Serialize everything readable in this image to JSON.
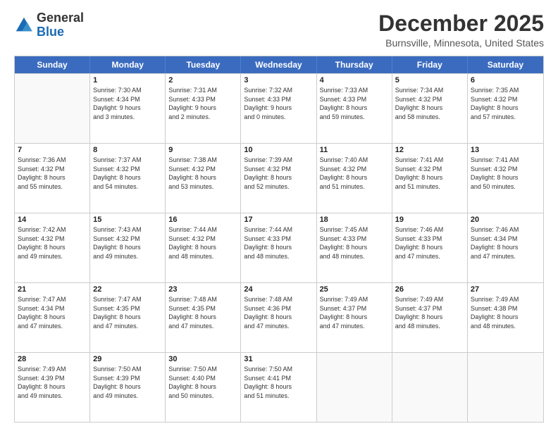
{
  "logo": {
    "general": "General",
    "blue": "Blue"
  },
  "title": "December 2025",
  "location": "Burnsville, Minnesota, United States",
  "days_of_week": [
    "Sunday",
    "Monday",
    "Tuesday",
    "Wednesday",
    "Thursday",
    "Friday",
    "Saturday"
  ],
  "weeks": [
    [
      {
        "num": "",
        "info": ""
      },
      {
        "num": "1",
        "info": "Sunrise: 7:30 AM\nSunset: 4:34 PM\nDaylight: 9 hours\nand 3 minutes."
      },
      {
        "num": "2",
        "info": "Sunrise: 7:31 AM\nSunset: 4:33 PM\nDaylight: 9 hours\nand 2 minutes."
      },
      {
        "num": "3",
        "info": "Sunrise: 7:32 AM\nSunset: 4:33 PM\nDaylight: 9 hours\nand 0 minutes."
      },
      {
        "num": "4",
        "info": "Sunrise: 7:33 AM\nSunset: 4:33 PM\nDaylight: 8 hours\nand 59 minutes."
      },
      {
        "num": "5",
        "info": "Sunrise: 7:34 AM\nSunset: 4:32 PM\nDaylight: 8 hours\nand 58 minutes."
      },
      {
        "num": "6",
        "info": "Sunrise: 7:35 AM\nSunset: 4:32 PM\nDaylight: 8 hours\nand 57 minutes."
      }
    ],
    [
      {
        "num": "7",
        "info": "Sunrise: 7:36 AM\nSunset: 4:32 PM\nDaylight: 8 hours\nand 55 minutes."
      },
      {
        "num": "8",
        "info": "Sunrise: 7:37 AM\nSunset: 4:32 PM\nDaylight: 8 hours\nand 54 minutes."
      },
      {
        "num": "9",
        "info": "Sunrise: 7:38 AM\nSunset: 4:32 PM\nDaylight: 8 hours\nand 53 minutes."
      },
      {
        "num": "10",
        "info": "Sunrise: 7:39 AM\nSunset: 4:32 PM\nDaylight: 8 hours\nand 52 minutes."
      },
      {
        "num": "11",
        "info": "Sunrise: 7:40 AM\nSunset: 4:32 PM\nDaylight: 8 hours\nand 51 minutes."
      },
      {
        "num": "12",
        "info": "Sunrise: 7:41 AM\nSunset: 4:32 PM\nDaylight: 8 hours\nand 51 minutes."
      },
      {
        "num": "13",
        "info": "Sunrise: 7:41 AM\nSunset: 4:32 PM\nDaylight: 8 hours\nand 50 minutes."
      }
    ],
    [
      {
        "num": "14",
        "info": "Sunrise: 7:42 AM\nSunset: 4:32 PM\nDaylight: 8 hours\nand 49 minutes."
      },
      {
        "num": "15",
        "info": "Sunrise: 7:43 AM\nSunset: 4:32 PM\nDaylight: 8 hours\nand 49 minutes."
      },
      {
        "num": "16",
        "info": "Sunrise: 7:44 AM\nSunset: 4:32 PM\nDaylight: 8 hours\nand 48 minutes."
      },
      {
        "num": "17",
        "info": "Sunrise: 7:44 AM\nSunset: 4:33 PM\nDaylight: 8 hours\nand 48 minutes."
      },
      {
        "num": "18",
        "info": "Sunrise: 7:45 AM\nSunset: 4:33 PM\nDaylight: 8 hours\nand 48 minutes."
      },
      {
        "num": "19",
        "info": "Sunrise: 7:46 AM\nSunset: 4:33 PM\nDaylight: 8 hours\nand 47 minutes."
      },
      {
        "num": "20",
        "info": "Sunrise: 7:46 AM\nSunset: 4:34 PM\nDaylight: 8 hours\nand 47 minutes."
      }
    ],
    [
      {
        "num": "21",
        "info": "Sunrise: 7:47 AM\nSunset: 4:34 PM\nDaylight: 8 hours\nand 47 minutes."
      },
      {
        "num": "22",
        "info": "Sunrise: 7:47 AM\nSunset: 4:35 PM\nDaylight: 8 hours\nand 47 minutes."
      },
      {
        "num": "23",
        "info": "Sunrise: 7:48 AM\nSunset: 4:35 PM\nDaylight: 8 hours\nand 47 minutes."
      },
      {
        "num": "24",
        "info": "Sunrise: 7:48 AM\nSunset: 4:36 PM\nDaylight: 8 hours\nand 47 minutes."
      },
      {
        "num": "25",
        "info": "Sunrise: 7:49 AM\nSunset: 4:37 PM\nDaylight: 8 hours\nand 47 minutes."
      },
      {
        "num": "26",
        "info": "Sunrise: 7:49 AM\nSunset: 4:37 PM\nDaylight: 8 hours\nand 48 minutes."
      },
      {
        "num": "27",
        "info": "Sunrise: 7:49 AM\nSunset: 4:38 PM\nDaylight: 8 hours\nand 48 minutes."
      }
    ],
    [
      {
        "num": "28",
        "info": "Sunrise: 7:49 AM\nSunset: 4:39 PM\nDaylight: 8 hours\nand 49 minutes."
      },
      {
        "num": "29",
        "info": "Sunrise: 7:50 AM\nSunset: 4:39 PM\nDaylight: 8 hours\nand 49 minutes."
      },
      {
        "num": "30",
        "info": "Sunrise: 7:50 AM\nSunset: 4:40 PM\nDaylight: 8 hours\nand 50 minutes."
      },
      {
        "num": "31",
        "info": "Sunrise: 7:50 AM\nSunset: 4:41 PM\nDaylight: 8 hours\nand 51 minutes."
      },
      {
        "num": "",
        "info": ""
      },
      {
        "num": "",
        "info": ""
      },
      {
        "num": "",
        "info": ""
      }
    ]
  ]
}
